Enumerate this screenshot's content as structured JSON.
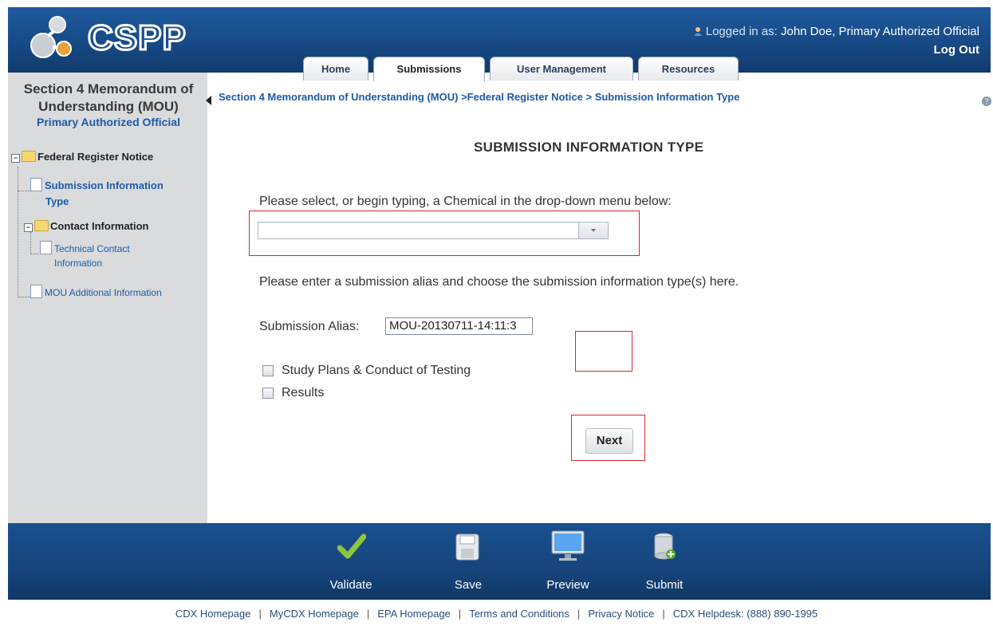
{
  "header": {
    "logo_text": "CSPP",
    "logged_in_label": "Logged in as:",
    "user_name": "John Doe, Primary Authorized Official",
    "logout": "Log Out",
    "tabs": [
      {
        "label": "Home"
      },
      {
        "label": "Submissions"
      },
      {
        "label": "User Management"
      },
      {
        "label": "Resources"
      }
    ]
  },
  "sidebar": {
    "title_line1": "Section 4 Memorandum of",
    "title_line2": "Understanding (MOU)",
    "subtitle": "Primary Authorized Official",
    "tree": {
      "root": "Federal Register Notice",
      "sub_info_line1": "Submission Information",
      "sub_info_line2": "Type",
      "contact": "Contact Information",
      "tech_line1": "Technical Contact",
      "tech_line2": "Information",
      "mou_additional": "MOU Additional Information"
    }
  },
  "main": {
    "breadcrumb": "Section 4 Memorandum of Understanding (MOU) >Federal Register Notice > Submission Information Type",
    "title": "SUBMISSION INFORMATION TYPE",
    "chemical_prompt": "Please select, or begin typing, a Chemical in the drop-down menu below:",
    "chemical_value": "",
    "alias_prompt": "Please enter a submission alias and choose the submission information type(s) here.",
    "alias_label": "Submission Alias:",
    "alias_value": "MOU-20130711-14:11:3",
    "checkbox_study": "Study Plans & Conduct of Testing",
    "checkbox_results": "Results",
    "next": "Next"
  },
  "toolbar": {
    "validate": "Validate",
    "save": "Save",
    "preview": "Preview",
    "submit": "Submit"
  },
  "footer_links": {
    "cdx_home": "CDX Homepage",
    "mycdx_home": "MyCDX Homepage",
    "epa_home": "EPA Homepage",
    "terms": "Terms and Conditions",
    "privacy": "Privacy Notice",
    "helpdesk": "CDX Helpdesk: (888) 890-1995",
    "separator": "|"
  },
  "colors": {
    "header_blue": "#174a86",
    "link_blue": "#1e5aa8",
    "highlight_red": "#d9252b",
    "sidebar_gray": "#dadbdd"
  },
  "icons": [
    "user-icon",
    "cspp-logo",
    "help-icon",
    "folder-icon",
    "document-icon",
    "chevron-down-icon",
    "checkmark-icon",
    "floppy-disk-icon",
    "monitor-icon",
    "database-submit-icon"
  ]
}
